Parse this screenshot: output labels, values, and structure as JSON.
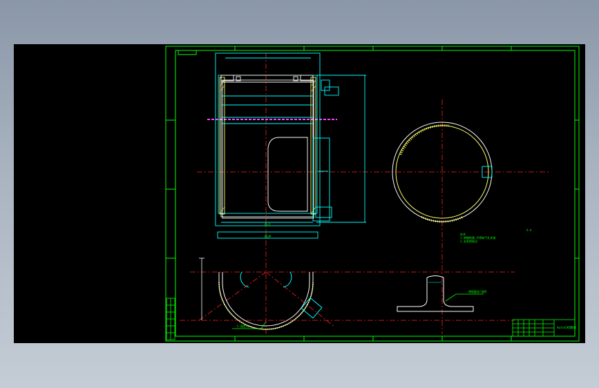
{
  "colors": {
    "background": "#000000",
    "frame": "#00ff00",
    "outline": "#ffffff",
    "dimension": "#00ffff",
    "centerline": "#ff2020",
    "hatch": "#ffff66",
    "magenta": "#ff44ff",
    "annotation": "#00ff00"
  },
  "icons": {
    "drawing": "cad-drawing-icon"
  },
  "labels": {
    "dim_label_a": "Ø□1",
    "dim_label_b": "Ø□4",
    "view_tag": "A-A",
    "leader_note": "2-固定孔",
    "note_line_1": "技术",
    "note_line_2": "1.焊缝饱满,不得有气孔夹渣",
    "note_line_3": "2.去毛刺锐边",
    "weld_note": "焊接要求/说明",
    "title_block_name": "AutoCAD图纸"
  }
}
